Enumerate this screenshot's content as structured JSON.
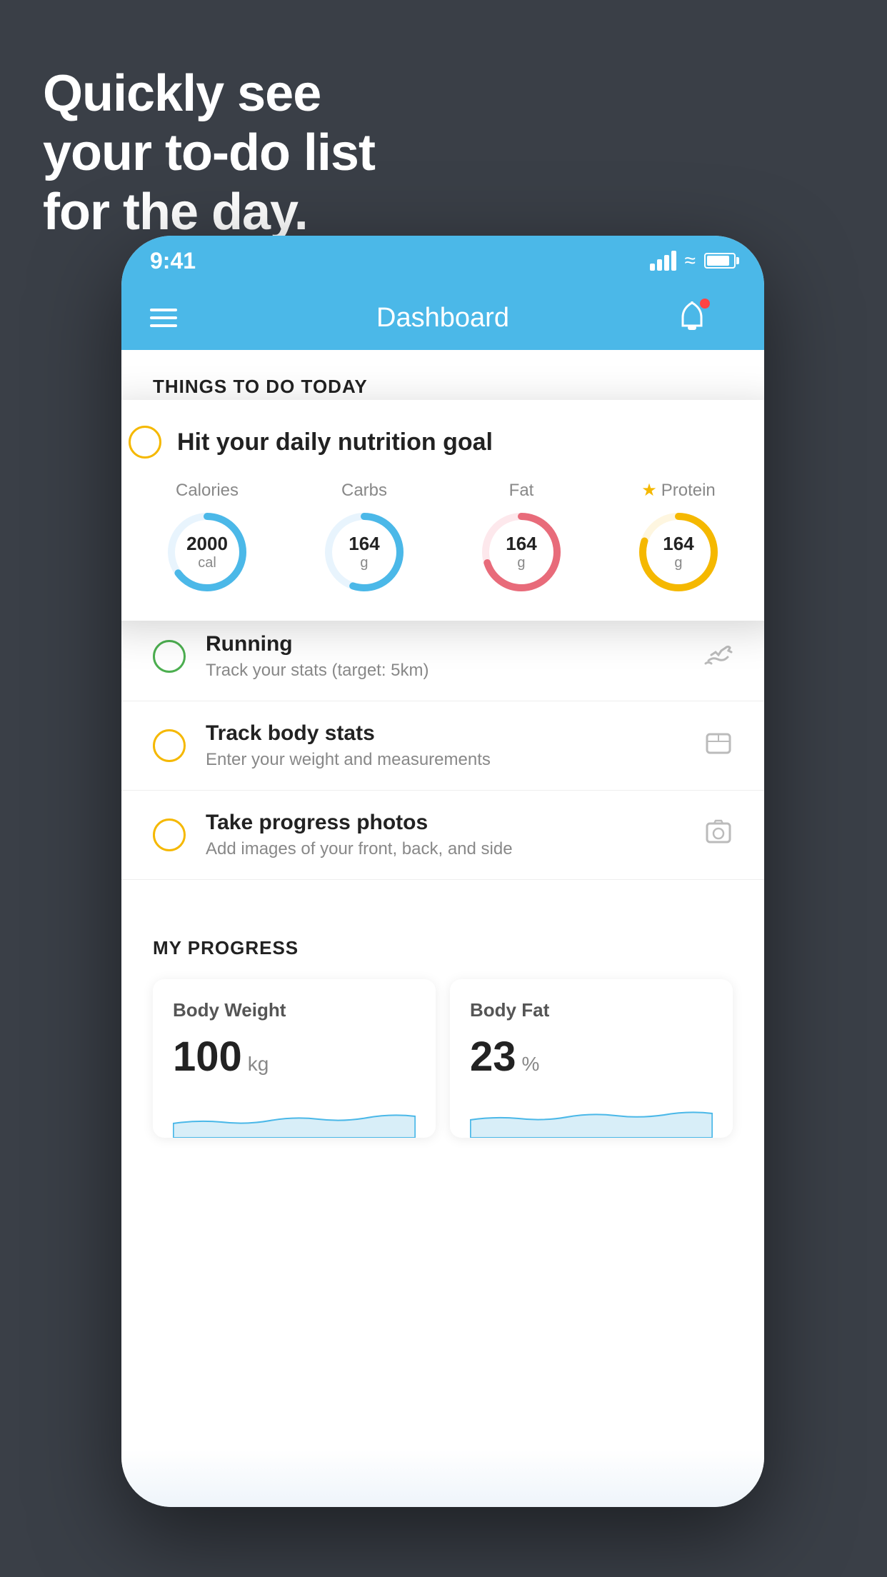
{
  "background": {
    "color": "#3a3f47"
  },
  "hero": {
    "line1": "Quickly see",
    "line2": "your to-do list",
    "line3": "for the day."
  },
  "phone": {
    "status_bar": {
      "time": "9:41",
      "signal": "signal",
      "wifi": "wifi",
      "battery": "battery"
    },
    "nav": {
      "title": "Dashboard",
      "menu_label": "menu",
      "bell_label": "notifications"
    },
    "section_today": {
      "header": "THINGS TO DO TODAY"
    },
    "nutrition_card": {
      "title": "Hit your daily nutrition goal",
      "items": [
        {
          "label": "Calories",
          "value": "2000",
          "unit": "cal",
          "color": "#4bb8e8",
          "percent": 65,
          "starred": false
        },
        {
          "label": "Carbs",
          "value": "164",
          "unit": "g",
          "color": "#4bb8e8",
          "percent": 55,
          "starred": false
        },
        {
          "label": "Fat",
          "value": "164",
          "unit": "g",
          "color": "#e86b7a",
          "percent": 70,
          "starred": false
        },
        {
          "label": "Protein",
          "value": "164",
          "unit": "g",
          "color": "#f5b800",
          "percent": 80,
          "starred": true
        }
      ]
    },
    "todo_items": [
      {
        "name": "Running",
        "desc": "Track your stats (target: 5km)",
        "circle_color": "green",
        "icon": "👟"
      },
      {
        "name": "Track body stats",
        "desc": "Enter your weight and measurements",
        "circle_color": "yellow",
        "icon": "⚖"
      },
      {
        "name": "Take progress photos",
        "desc": "Add images of your front, back, and side",
        "circle_color": "yellow",
        "icon": "👤"
      }
    ],
    "progress_section": {
      "header": "MY PROGRESS",
      "cards": [
        {
          "title": "Body Weight",
          "value": "100",
          "unit": "kg"
        },
        {
          "title": "Body Fat",
          "value": "23",
          "unit": "%"
        }
      ]
    }
  }
}
